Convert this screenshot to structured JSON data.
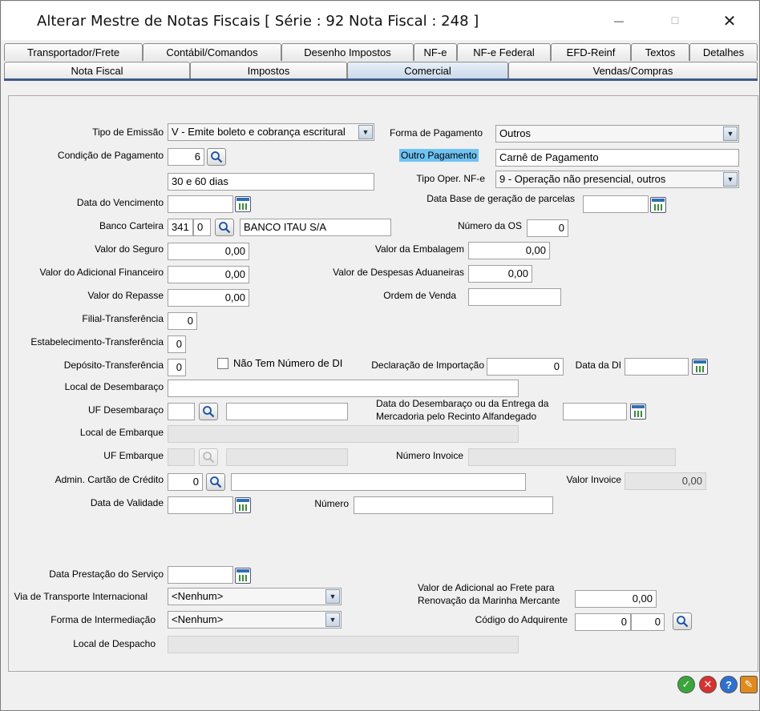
{
  "window": {
    "title": "Alterar Mestre de Notas Fiscais [ Série : 92  Nota Fiscal : 248 ]",
    "minimize": "—",
    "maximize": "☐",
    "close": "✕"
  },
  "tabs_top": [
    "Transportador/Frete",
    "Contábil/Comandos",
    "Desenho Impostos",
    "NF-e",
    "NF-e Federal",
    "EFD-Reinf",
    "Textos",
    "Detalhes"
  ],
  "tabs_bottom": [
    "Nota Fiscal",
    "Impostos",
    "Comercial",
    "Vendas/Compras"
  ],
  "active_tab": "Comercial",
  "form": {
    "tipo_emissao_label": "Tipo de Emissão",
    "tipo_emissao_value": "V - Emite boleto e cobrança escritural",
    "forma_pagamento_label": "Forma de Pagamento",
    "forma_pagamento_value": "Outros",
    "condicao_pagamento_label": "Condição de Pagamento",
    "condicao_pagamento_value": "6",
    "condicao_descricao": "30 e 60 dias",
    "outro_pagamento_label": "Outro Pagamento",
    "outro_pagamento_value": "Carnê de Pagamento",
    "tipo_oper_label": "Tipo Oper. NF-e",
    "tipo_oper_value": "9 - Operação não presencial, outros",
    "data_vencimento_label": "Data do Vencimento",
    "data_base_label": "Data Base de geração de parcelas",
    "banco_carteira_label": "Banco Carteira",
    "banco_value": "341",
    "carteira_value": "0",
    "banco_nome": "BANCO ITAU S/A",
    "numero_os_label": "Número da OS",
    "numero_os_value": "0",
    "valor_seguro_label": "Valor do Seguro",
    "valor_seguro_value": "0,00",
    "valor_embalagem_label": "Valor da Embalagem",
    "valor_embalagem_value": "0,00",
    "valor_adicional_fin_label": "Valor do Adicional Financeiro",
    "valor_adicional_fin_value": "0,00",
    "valor_despesas_adu_label": "Valor de Despesas Aduaneiras",
    "valor_despesas_adu_value": "0,00",
    "valor_repasse_label": "Valor do Repasse",
    "valor_repasse_value": "0,00",
    "ordem_venda_label": "Ordem de Venda",
    "filial_transf_label": "Filial-Transferência",
    "filial_transf_value": "0",
    "estab_transf_label": "Estabelecimento-Transferência",
    "estab_transf_value": "0",
    "deposito_transf_label": "Depósito-Transferência",
    "deposito_transf_value": "0",
    "nao_tem_di_label": "Não Tem Número de DI",
    "declaracao_importacao_label": "Declaração de Importação",
    "declaracao_importacao_value": "0",
    "data_di_label": "Data da DI",
    "local_desembaraco_label": "Local de Desembaraço",
    "uf_desembaraco_label": "UF Desembaraço",
    "data_desembaraco_label_1": "Data do Desembaraço ou da Entrega da",
    "data_desembaraco_label_2": "Mercadoria pelo Recinto Alfandegado",
    "local_embarque_label": "Local de Embarque",
    "uf_embarque_label": "UF Embarque",
    "numero_invoice_label": "Número Invoice",
    "admin_cartao_label": "Admin. Cartão de Crédito",
    "admin_cartao_value": "0",
    "valor_invoice_label": "Valor Invoice",
    "valor_invoice_value": "0,00",
    "data_validade_label": "Data de Validade",
    "numero_label": "Número",
    "data_prestacao_label": "Data Prestação do Serviço",
    "via_transporte_label": "Via de Transporte Internacional",
    "via_transporte_value": "<Nenhum>",
    "valor_afrmm_label_1": "Valor de Adicional ao Frete para",
    "valor_afrmm_label_2": "Renovação da Marinha Mercante",
    "valor_afrmm_value": "0,00",
    "forma_intermediacao_label": "Forma de Intermediação",
    "forma_intermediacao_value": "<Nenhum>",
    "codigo_adquirente_label": "Código do Adquirente",
    "codigo_adquirente_value_1": "0",
    "codigo_adquirente_value_2": "0",
    "local_despacho_label": "Local de Despacho"
  },
  "footer_buttons": {
    "ok": "✓",
    "cancel": "✕",
    "help": "?",
    "tools": "✎"
  },
  "colors": {
    "active_tab": "#c9d8ea",
    "highlight": "#6ec3f2",
    "ok": "#3aa53a",
    "cancel": "#d93030",
    "help": "#2f6fd0",
    "tools": "#e08a1c"
  }
}
